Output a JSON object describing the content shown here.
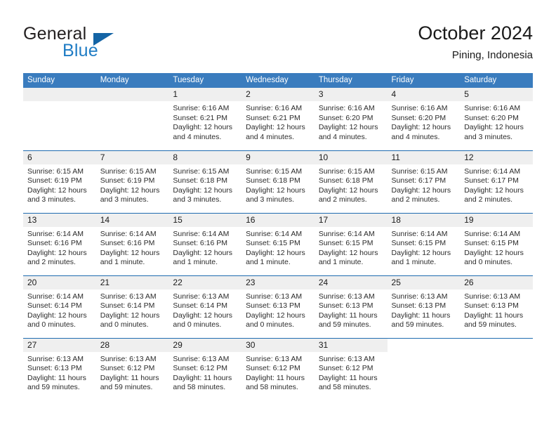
{
  "brand": {
    "name_part1": "General",
    "name_part2": "Blue",
    "logo_icon": "triangle-logo-icon"
  },
  "header": {
    "title": "October 2024",
    "subtitle": "Pining, Indonesia"
  },
  "colors": {
    "header_blue": "#3a7cbe",
    "row_divider_blue": "#1f6cb0",
    "date_band_gray": "#efefef",
    "brand_blue": "#1f7cc4",
    "logo_blue": "#1464a5"
  },
  "weekdays": [
    "Sunday",
    "Monday",
    "Tuesday",
    "Wednesday",
    "Thursday",
    "Friday",
    "Saturday"
  ],
  "weeks": [
    [
      {
        "blank": true,
        "shaded": true
      },
      {
        "blank": true,
        "shaded": true
      },
      {
        "day": "1",
        "sunrise": "Sunrise: 6:16 AM",
        "sunset": "Sunset: 6:21 PM",
        "daylight1": "Daylight: 12 hours",
        "daylight2": "and 4 minutes."
      },
      {
        "day": "2",
        "sunrise": "Sunrise: 6:16 AM",
        "sunset": "Sunset: 6:21 PM",
        "daylight1": "Daylight: 12 hours",
        "daylight2": "and 4 minutes."
      },
      {
        "day": "3",
        "sunrise": "Sunrise: 6:16 AM",
        "sunset": "Sunset: 6:20 PM",
        "daylight1": "Daylight: 12 hours",
        "daylight2": "and 4 minutes."
      },
      {
        "day": "4",
        "sunrise": "Sunrise: 6:16 AM",
        "sunset": "Sunset: 6:20 PM",
        "daylight1": "Daylight: 12 hours",
        "daylight2": "and 4 minutes."
      },
      {
        "day": "5",
        "sunrise": "Sunrise: 6:16 AM",
        "sunset": "Sunset: 6:20 PM",
        "daylight1": "Daylight: 12 hours",
        "daylight2": "and 3 minutes."
      }
    ],
    [
      {
        "day": "6",
        "sunrise": "Sunrise: 6:15 AM",
        "sunset": "Sunset: 6:19 PM",
        "daylight1": "Daylight: 12 hours",
        "daylight2": "and 3 minutes."
      },
      {
        "day": "7",
        "sunrise": "Sunrise: 6:15 AM",
        "sunset": "Sunset: 6:19 PM",
        "daylight1": "Daylight: 12 hours",
        "daylight2": "and 3 minutes."
      },
      {
        "day": "8",
        "sunrise": "Sunrise: 6:15 AM",
        "sunset": "Sunset: 6:18 PM",
        "daylight1": "Daylight: 12 hours",
        "daylight2": "and 3 minutes."
      },
      {
        "day": "9",
        "sunrise": "Sunrise: 6:15 AM",
        "sunset": "Sunset: 6:18 PM",
        "daylight1": "Daylight: 12 hours",
        "daylight2": "and 3 minutes."
      },
      {
        "day": "10",
        "sunrise": "Sunrise: 6:15 AM",
        "sunset": "Sunset: 6:18 PM",
        "daylight1": "Daylight: 12 hours",
        "daylight2": "and 2 minutes."
      },
      {
        "day": "11",
        "sunrise": "Sunrise: 6:15 AM",
        "sunset": "Sunset: 6:17 PM",
        "daylight1": "Daylight: 12 hours",
        "daylight2": "and 2 minutes."
      },
      {
        "day": "12",
        "sunrise": "Sunrise: 6:14 AM",
        "sunset": "Sunset: 6:17 PM",
        "daylight1": "Daylight: 12 hours",
        "daylight2": "and 2 minutes."
      }
    ],
    [
      {
        "day": "13",
        "sunrise": "Sunrise: 6:14 AM",
        "sunset": "Sunset: 6:16 PM",
        "daylight1": "Daylight: 12 hours",
        "daylight2": "and 2 minutes."
      },
      {
        "day": "14",
        "sunrise": "Sunrise: 6:14 AM",
        "sunset": "Sunset: 6:16 PM",
        "daylight1": "Daylight: 12 hours",
        "daylight2": "and 1 minute."
      },
      {
        "day": "15",
        "sunrise": "Sunrise: 6:14 AM",
        "sunset": "Sunset: 6:16 PM",
        "daylight1": "Daylight: 12 hours",
        "daylight2": "and 1 minute."
      },
      {
        "day": "16",
        "sunrise": "Sunrise: 6:14 AM",
        "sunset": "Sunset: 6:15 PM",
        "daylight1": "Daylight: 12 hours",
        "daylight2": "and 1 minute."
      },
      {
        "day": "17",
        "sunrise": "Sunrise: 6:14 AM",
        "sunset": "Sunset: 6:15 PM",
        "daylight1": "Daylight: 12 hours",
        "daylight2": "and 1 minute."
      },
      {
        "day": "18",
        "sunrise": "Sunrise: 6:14 AM",
        "sunset": "Sunset: 6:15 PM",
        "daylight1": "Daylight: 12 hours",
        "daylight2": "and 1 minute."
      },
      {
        "day": "19",
        "sunrise": "Sunrise: 6:14 AM",
        "sunset": "Sunset: 6:15 PM",
        "daylight1": "Daylight: 12 hours",
        "daylight2": "and 0 minutes."
      }
    ],
    [
      {
        "day": "20",
        "sunrise": "Sunrise: 6:14 AM",
        "sunset": "Sunset: 6:14 PM",
        "daylight1": "Daylight: 12 hours",
        "daylight2": "and 0 minutes."
      },
      {
        "day": "21",
        "sunrise": "Sunrise: 6:13 AM",
        "sunset": "Sunset: 6:14 PM",
        "daylight1": "Daylight: 12 hours",
        "daylight2": "and 0 minutes."
      },
      {
        "day": "22",
        "sunrise": "Sunrise: 6:13 AM",
        "sunset": "Sunset: 6:14 PM",
        "daylight1": "Daylight: 12 hours",
        "daylight2": "and 0 minutes."
      },
      {
        "day": "23",
        "sunrise": "Sunrise: 6:13 AM",
        "sunset": "Sunset: 6:13 PM",
        "daylight1": "Daylight: 12 hours",
        "daylight2": "and 0 minutes."
      },
      {
        "day": "24",
        "sunrise": "Sunrise: 6:13 AM",
        "sunset": "Sunset: 6:13 PM",
        "daylight1": "Daylight: 11 hours",
        "daylight2": "and 59 minutes."
      },
      {
        "day": "25",
        "sunrise": "Sunrise: 6:13 AM",
        "sunset": "Sunset: 6:13 PM",
        "daylight1": "Daylight: 11 hours",
        "daylight2": "and 59 minutes."
      },
      {
        "day": "26",
        "sunrise": "Sunrise: 6:13 AM",
        "sunset": "Sunset: 6:13 PM",
        "daylight1": "Daylight: 11 hours",
        "daylight2": "and 59 minutes."
      }
    ],
    [
      {
        "day": "27",
        "sunrise": "Sunrise: 6:13 AM",
        "sunset": "Sunset: 6:13 PM",
        "daylight1": "Daylight: 11 hours",
        "daylight2": "and 59 minutes."
      },
      {
        "day": "28",
        "sunrise": "Sunrise: 6:13 AM",
        "sunset": "Sunset: 6:12 PM",
        "daylight1": "Daylight: 11 hours",
        "daylight2": "and 59 minutes."
      },
      {
        "day": "29",
        "sunrise": "Sunrise: 6:13 AM",
        "sunset": "Sunset: 6:12 PM",
        "daylight1": "Daylight: 11 hours",
        "daylight2": "and 58 minutes."
      },
      {
        "day": "30",
        "sunrise": "Sunrise: 6:13 AM",
        "sunset": "Sunset: 6:12 PM",
        "daylight1": "Daylight: 11 hours",
        "daylight2": "and 58 minutes."
      },
      {
        "day": "31",
        "sunrise": "Sunrise: 6:13 AM",
        "sunset": "Sunset: 6:12 PM",
        "daylight1": "Daylight: 11 hours",
        "daylight2": "and 58 minutes."
      },
      {
        "blank": true,
        "shaded": false
      },
      {
        "blank": true,
        "shaded": false
      }
    ]
  ]
}
